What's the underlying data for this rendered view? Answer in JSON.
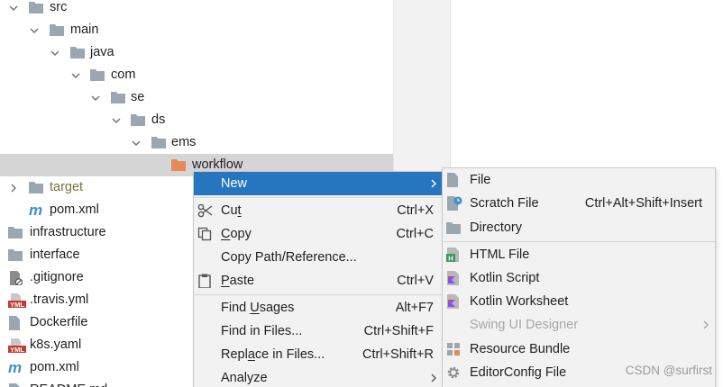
{
  "tree": {
    "items": [
      {
        "label": "src",
        "icon": "folder-icon",
        "expanded": true
      },
      {
        "label": "main",
        "icon": "folder-icon",
        "expanded": true
      },
      {
        "label": "java",
        "icon": "folder-icon",
        "expanded": true
      },
      {
        "label": "com",
        "icon": "folder-icon",
        "expanded": true
      },
      {
        "label": "se",
        "icon": "folder-icon",
        "expanded": true
      },
      {
        "label": "ds",
        "icon": "folder-icon",
        "expanded": true
      },
      {
        "label": "ems",
        "icon": "folder-icon",
        "expanded": true
      },
      {
        "label": "workflow",
        "icon": "package-folder-icon",
        "selected": true
      },
      {
        "label": "target",
        "icon": "folder-icon",
        "expanded": false
      },
      {
        "label": "pom.xml",
        "icon": "maven-icon"
      },
      {
        "label": "infrastructure",
        "icon": "folder-icon"
      },
      {
        "label": "interface",
        "icon": "folder-icon"
      },
      {
        "label": ".gitignore",
        "icon": "ignore-file-icon"
      },
      {
        "label": ".travis.yml",
        "icon": "yaml-icon"
      },
      {
        "label": "Dockerfile",
        "icon": "text-file-icon"
      },
      {
        "label": "k8s.yaml",
        "icon": "yaml-icon"
      },
      {
        "label": "pom.xml",
        "icon": "maven-icon"
      },
      {
        "label": "README.md",
        "icon": "markdown-icon"
      }
    ]
  },
  "context_menu": {
    "new": {
      "label": "New"
    },
    "cut": {
      "pre": "Cu",
      "u": "t",
      "post": "",
      "shortcut": "Ctrl+X"
    },
    "copy": {
      "pre": "",
      "u": "C",
      "post": "opy",
      "shortcut": "Ctrl+C"
    },
    "copy_path": {
      "label": "Copy Path/Reference..."
    },
    "paste": {
      "pre": "",
      "u": "P",
      "post": "aste",
      "shortcut": "Ctrl+V"
    },
    "find_usages": {
      "pre": "Find ",
      "u": "U",
      "post": "sages",
      "shortcut": "Alt+F7"
    },
    "find_in_files": {
      "label": "Find in Files...",
      "shortcut": "Ctrl+Shift+F"
    },
    "replace_in_files": {
      "pre": "Repl",
      "u": "a",
      "post": "ce in Files...",
      "shortcut": "Ctrl+Shift+R"
    },
    "analyze": {
      "label": "Analyze"
    }
  },
  "new_submenu": {
    "file": {
      "label": "File"
    },
    "scratch_file": {
      "label": "Scratch File",
      "shortcut": "Ctrl+Alt+Shift+Insert"
    },
    "directory": {
      "label": "Directory"
    },
    "html_file": {
      "label": "HTML File"
    },
    "kotlin_script": {
      "label": "Kotlin Script"
    },
    "kotlin_worksheet": {
      "label": "Kotlin Worksheet"
    },
    "swing_ui_designer": {
      "label": "Swing UI Designer",
      "disabled": true
    },
    "resource_bundle": {
      "label": "Resource Bundle"
    },
    "editorconfig_file": {
      "label": "EditorConfig File"
    }
  },
  "watermark": "CSDN @surfirst",
  "colors": {
    "selection": "#2675bf",
    "folder": "#9aa7b0",
    "package_folder": "#e8875a",
    "tree_selected_row": "#d5d5d5"
  }
}
